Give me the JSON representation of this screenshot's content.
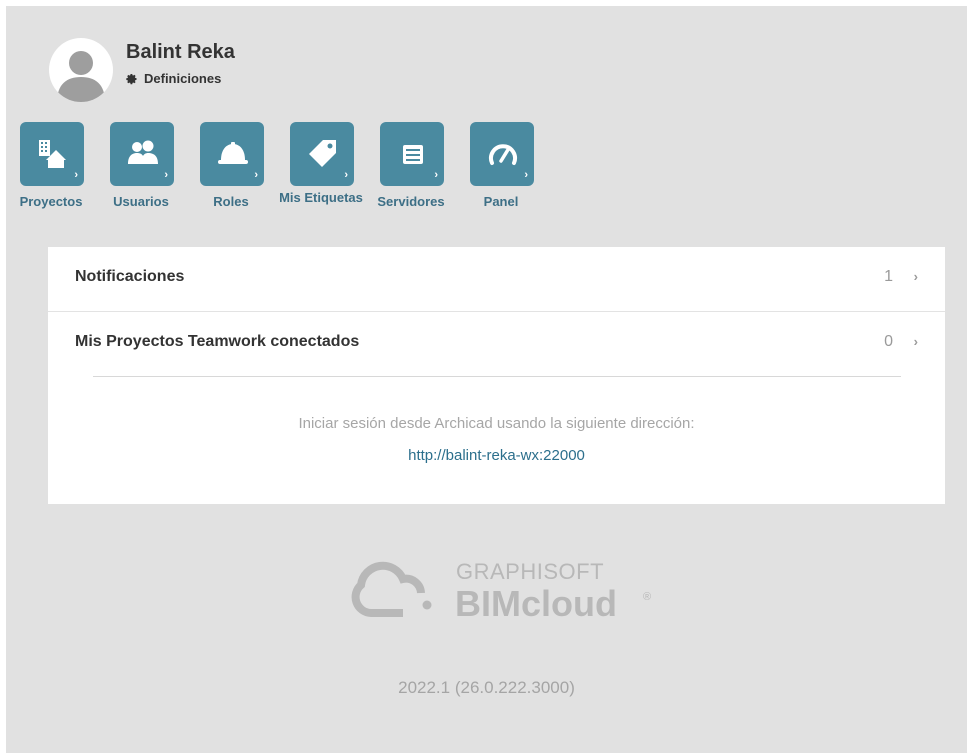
{
  "user": {
    "name": "Balint Reka",
    "settings_label": "Definiciones"
  },
  "nav": [
    {
      "label": "Proyectos",
      "icon": "projects-icon"
    },
    {
      "label": "Usuarios",
      "icon": "users-icon"
    },
    {
      "label": "Roles",
      "icon": "hard-hat-icon"
    },
    {
      "label": "Mis Etiquetas",
      "icon": "tag-icon"
    },
    {
      "label": "Servidores",
      "icon": "server-icon"
    },
    {
      "label": "Panel",
      "icon": "gauge-icon"
    }
  ],
  "panel": {
    "notifications": {
      "label": "Notificaciones",
      "count": "1"
    },
    "teamwork": {
      "label": "Mis Proyectos Teamwork conectados",
      "count": "0"
    },
    "login_hint": "Iniciar sesión desde Archicad usando la siguiente dirección:",
    "server_url": "http://balint-reka-wx:22000"
  },
  "branding": {
    "company": "GRAPHISOFT",
    "product": "BIMcloud",
    "registered": "®"
  },
  "version": "2022.1 (26.0.222.3000)",
  "colors": {
    "background": "#e1e1e1",
    "tile": "#4a8aa0",
    "tile_label": "#3d6f86",
    "link": "#2c6f8c"
  }
}
